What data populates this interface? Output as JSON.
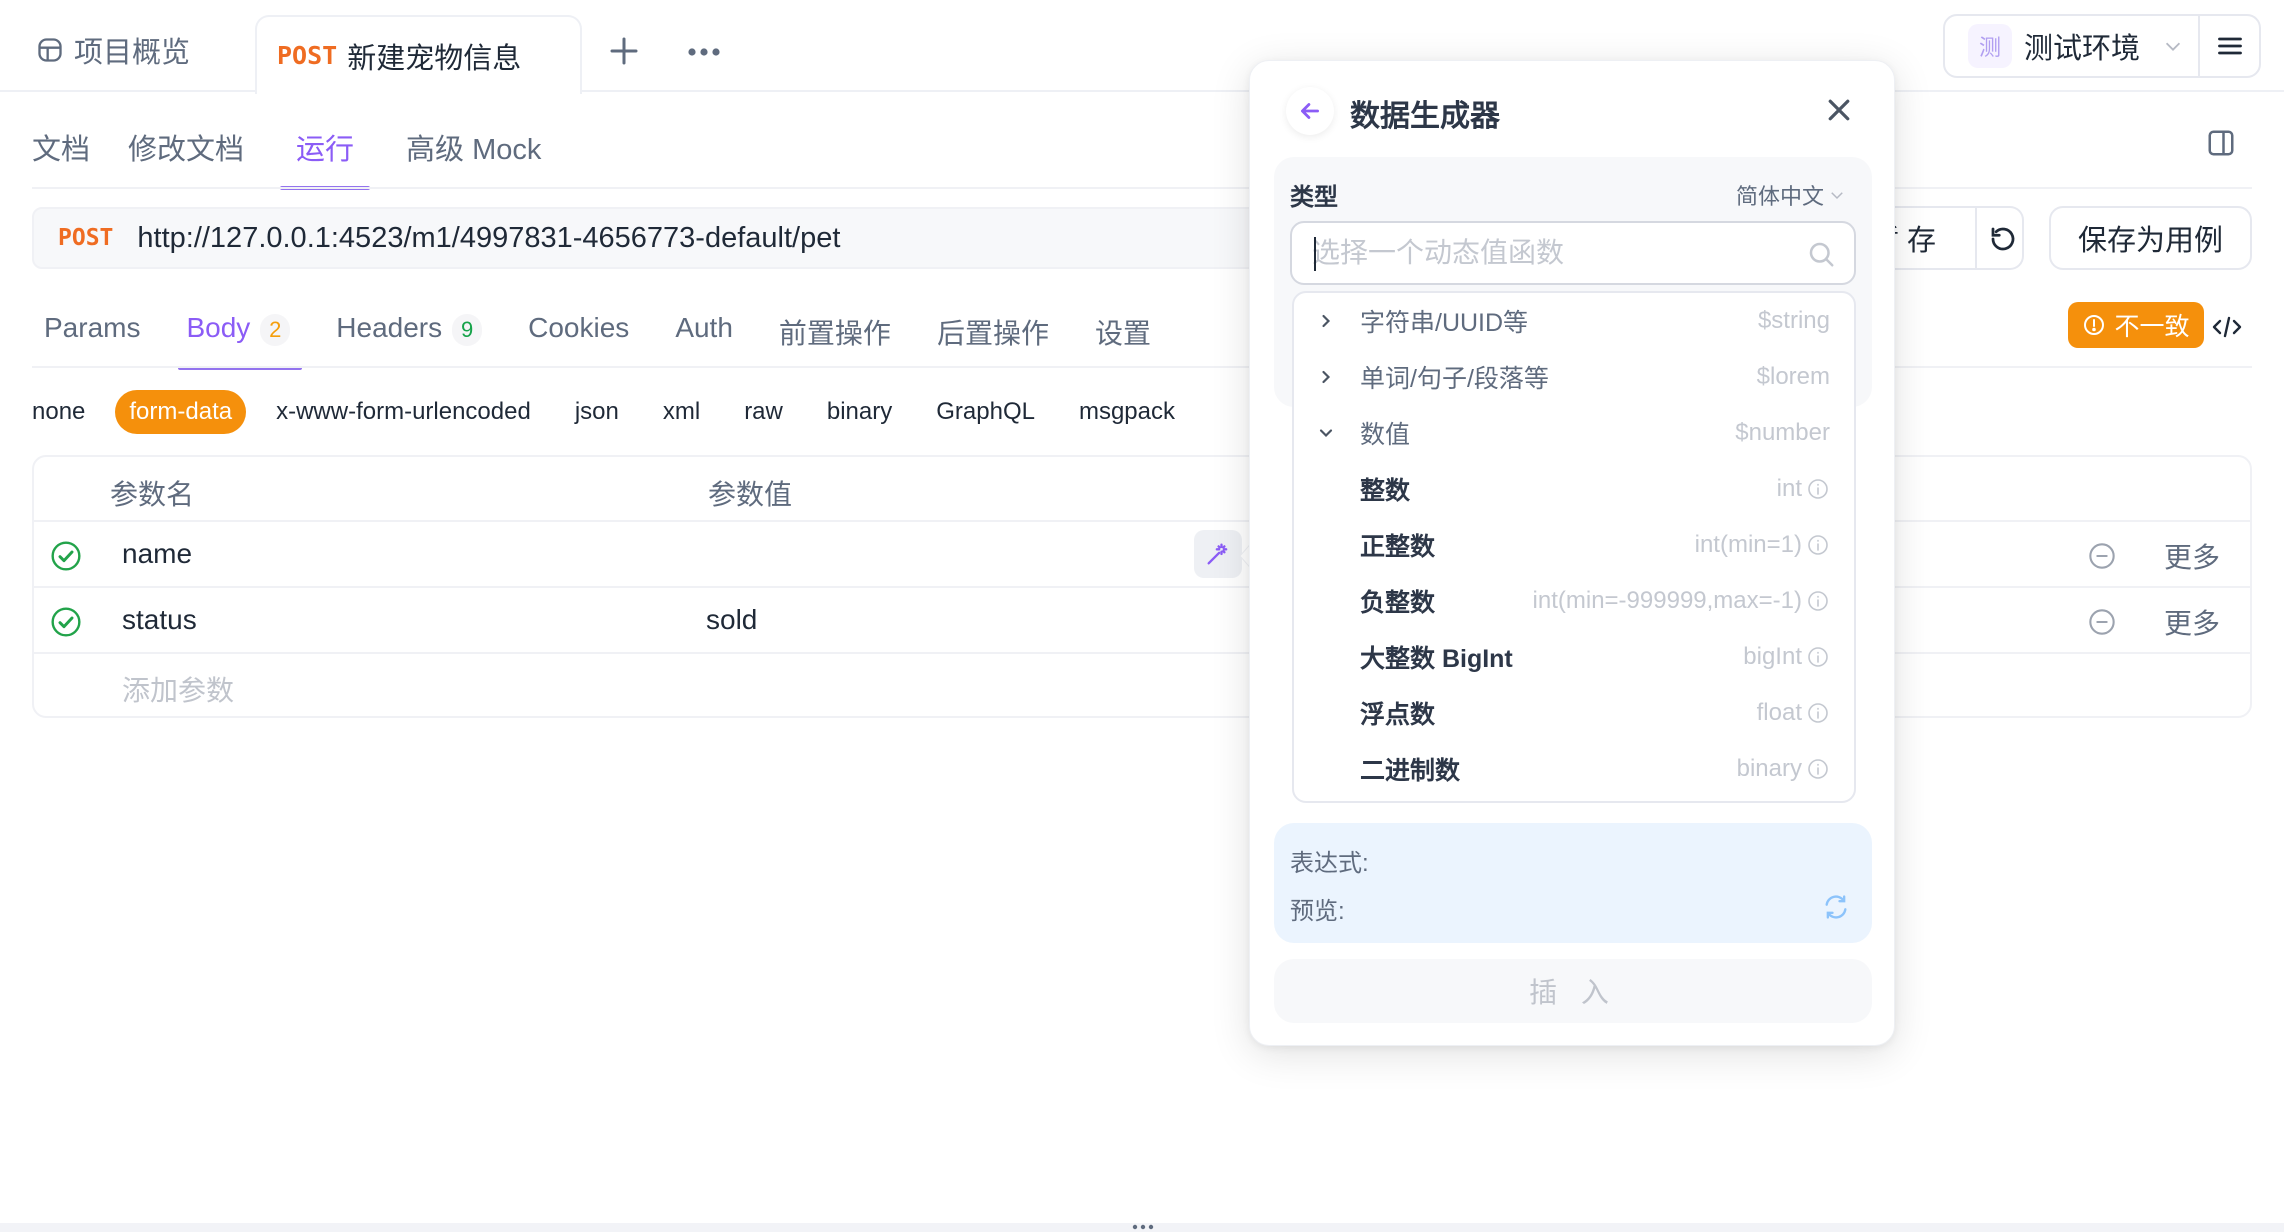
{
  "topbar": {
    "overview_tab": "项目概览",
    "active_tab": {
      "method": "POST",
      "name": "新建宠物信息"
    },
    "environment": {
      "badge": "测",
      "name": "测试环境"
    }
  },
  "subtabs": [
    "文档",
    "修改文档",
    "运行",
    "高级 Mock"
  ],
  "subtabs_active": "运行",
  "request": {
    "method": "POST",
    "url": "http://127.0.0.1:4523/m1/4997831-4656773-default/pet",
    "save_label": "暂 存",
    "save_as_case_label": "保存为用例"
  },
  "param_tabs": [
    {
      "label": "Params"
    },
    {
      "label": "Body",
      "count": "2"
    },
    {
      "label": "Headers",
      "count": "9"
    },
    {
      "label": "Cookies"
    },
    {
      "label": "Auth"
    },
    {
      "label": "前置操作"
    },
    {
      "label": "后置操作"
    },
    {
      "label": "设置"
    }
  ],
  "param_tabs_active": "Body",
  "mismatch_badge": "不一致",
  "body_types": [
    "none",
    "form-data",
    "x-www-form-urlencoded",
    "json",
    "xml",
    "raw",
    "binary",
    "GraphQL",
    "msgpack"
  ],
  "body_type_active": "form-data",
  "table": {
    "headers": [
      "参数名",
      "参数值"
    ],
    "rows": [
      {
        "enabled": true,
        "name": "name",
        "value": "",
        "more": "更多"
      },
      {
        "enabled": true,
        "name": "status",
        "value": "sold",
        "more": "更多"
      }
    ],
    "add_placeholder": "添加参数"
  },
  "generator": {
    "title": "数据生成器",
    "type_label": "类型",
    "language": "简体中文",
    "search_placeholder": "选择一个动态值函数",
    "items": [
      {
        "kind": "group",
        "expanded": false,
        "label": "字符串/UUID等",
        "code": "$string"
      },
      {
        "kind": "group",
        "expanded": false,
        "label": "单词/句子/段落等",
        "code": "$lorem"
      },
      {
        "kind": "group",
        "expanded": true,
        "label": "数值",
        "code": "$number"
      },
      {
        "kind": "item",
        "label": "整数",
        "code": "int"
      },
      {
        "kind": "item",
        "label": "正整数",
        "code": "int(min=1)"
      },
      {
        "kind": "item",
        "label": "负整数",
        "code": "int(min=-999999,max=-1)"
      },
      {
        "kind": "item",
        "label": "大整数 BigInt",
        "code": "bigInt"
      },
      {
        "kind": "item",
        "label": "浮点数",
        "code": "float"
      },
      {
        "kind": "item",
        "label": "二进制数",
        "code": "binary"
      }
    ],
    "expression_label": "表达式:",
    "preview_label": "预览:",
    "insert_label": "插 入"
  },
  "colors": {
    "accent": "#8b5cf6",
    "method_post": "#ef6c22",
    "form_data_active": "#f5900c",
    "mismatch": "#f5900c",
    "check": "#22a34a"
  }
}
